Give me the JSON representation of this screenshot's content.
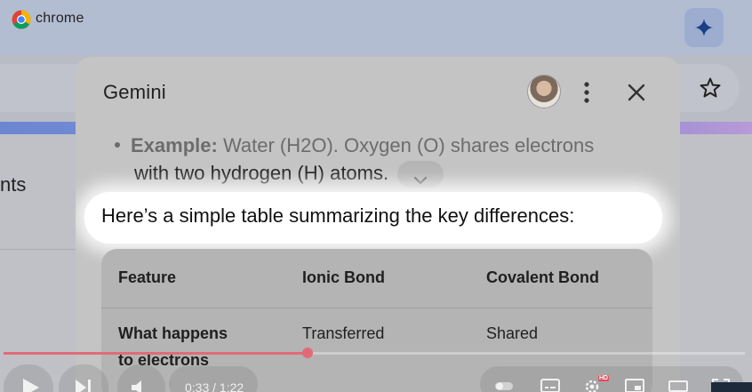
{
  "browser": {
    "brand": "chrome",
    "page_partial_text": "nts"
  },
  "panel": {
    "title": "Gemini",
    "bullet_label": "Example:",
    "bullet_text": " Water (H2O). Oxygen (O) shares electrons",
    "bullet_continuation": "with two hydrogen (H) atoms.",
    "highlight_text": "Here’s a simple table summarizing the key differences:"
  },
  "table": {
    "headers": [
      "Feature",
      "Ionic Bond",
      "Covalent Bond"
    ],
    "rows": [
      [
        "What happens to electrons",
        "Transferred",
        "Shared"
      ]
    ],
    "row0_feature_line1": "What happens",
    "row0_feature_line2": "to electrons"
  },
  "video": {
    "time": "0:33 / 1:22",
    "progress": 0.41,
    "quality_badge": "HD"
  },
  "colors": {
    "progress": "#e26a78",
    "accent_strip": "#7f97da"
  }
}
